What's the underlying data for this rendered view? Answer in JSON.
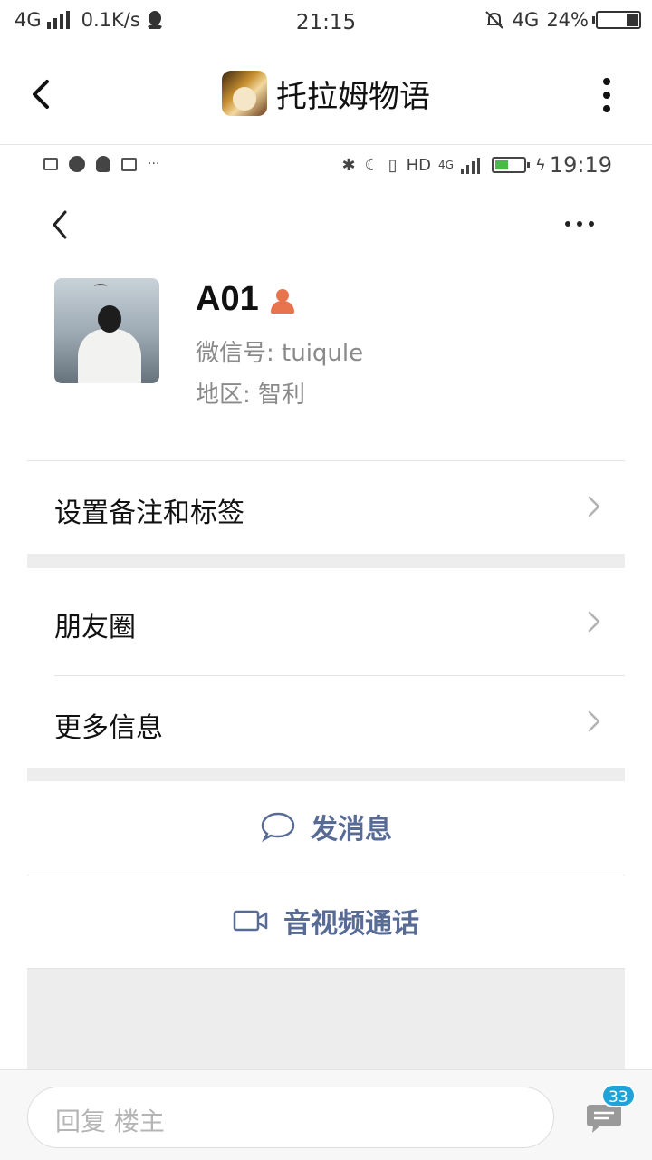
{
  "status_bar": {
    "network": "4G",
    "speed": "0.1K/s",
    "time": "21:15",
    "net_right": "4G",
    "battery": "24%"
  },
  "app_bar": {
    "title": "托拉姆物语"
  },
  "inner_status": {
    "hd": "HD",
    "net": "4G",
    "time": "19:19"
  },
  "profile": {
    "name": "A01",
    "wechat_id": "微信号: tuiqule",
    "region": "地区: 智利"
  },
  "menu": {
    "remark_tags": "设置备注和标签",
    "moments": "朋友圈",
    "more_info": "更多信息"
  },
  "actions": {
    "send_message": "发消息",
    "av_call": "音视频通话"
  },
  "reply": {
    "placeholder": "回复  楼主",
    "comment_count": "33"
  },
  "colors": {
    "action_text": "#576b95",
    "badge": "#1ea4d9",
    "gender_icon": "#e8734f"
  }
}
